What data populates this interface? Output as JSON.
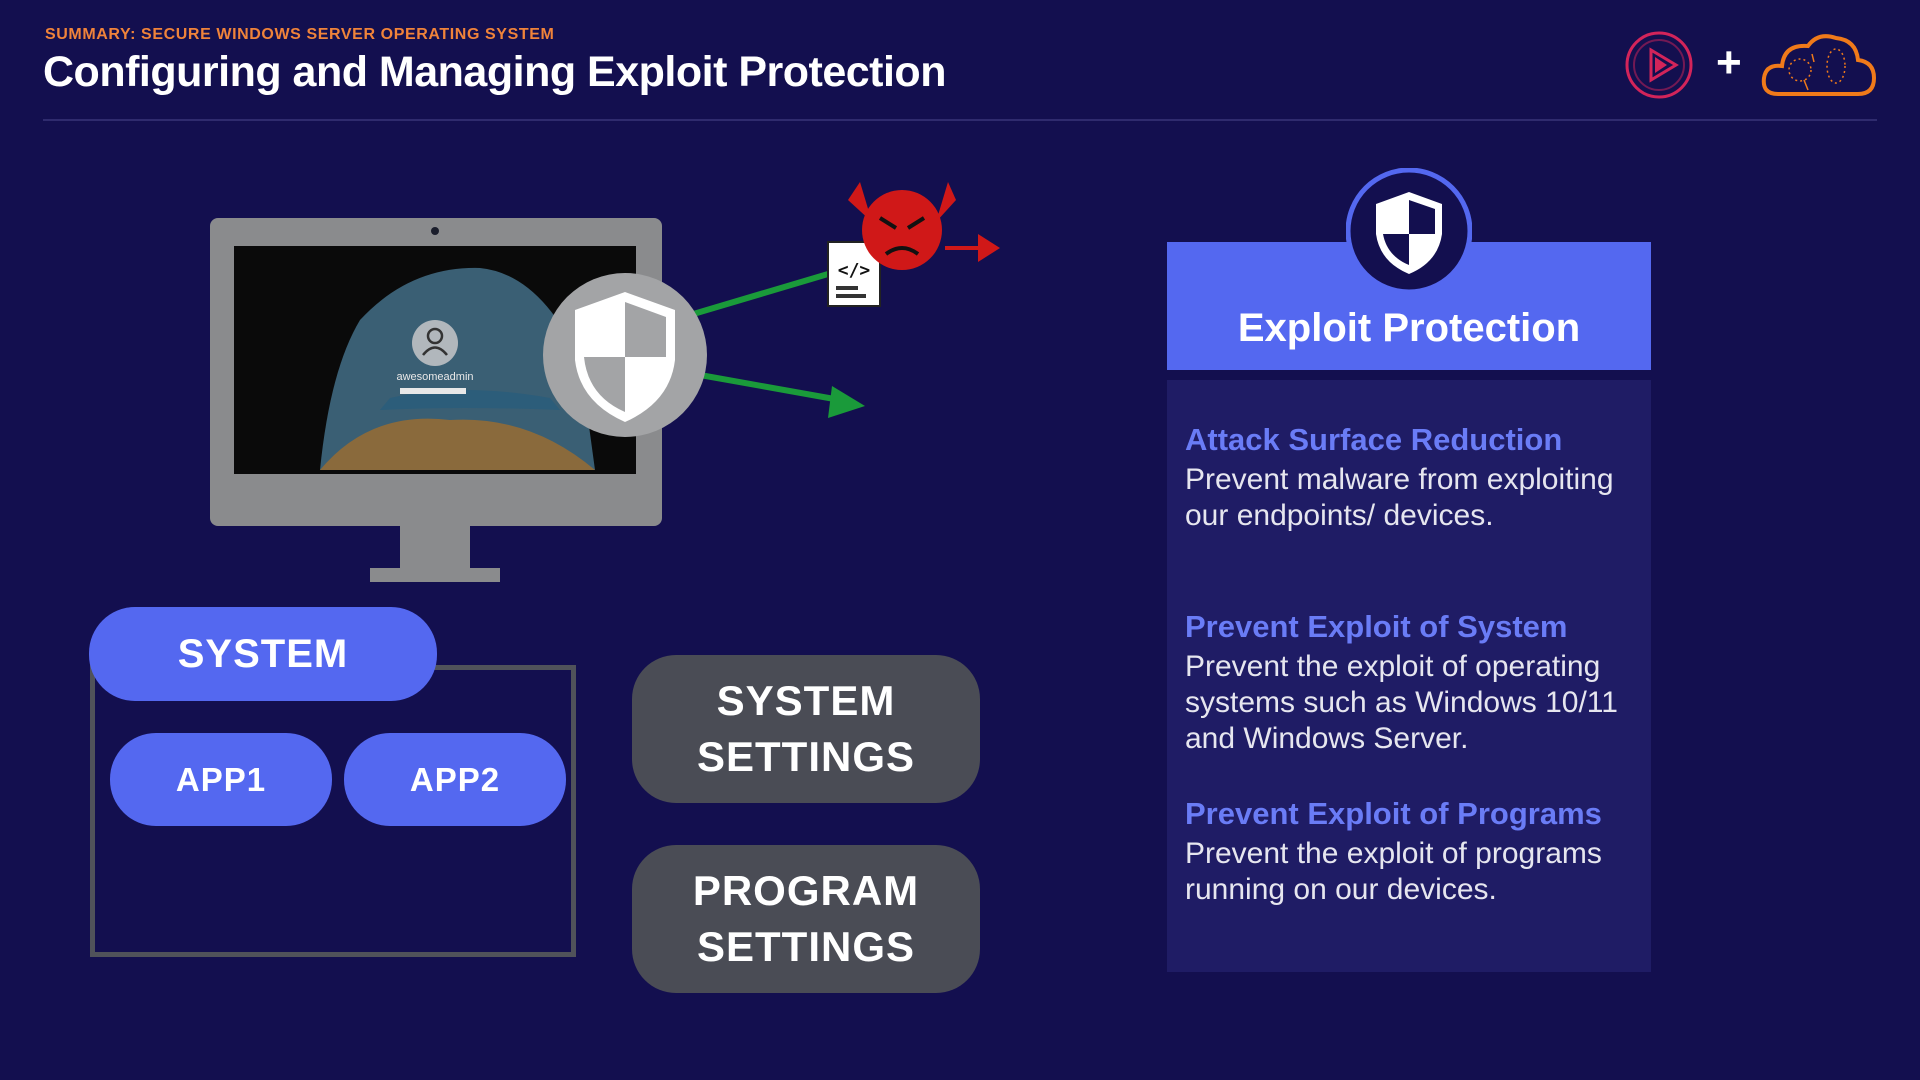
{
  "header": {
    "eyebrow": "SUMMARY: SECURE WINDOWS SERVER OPERATING SYSTEM",
    "title": "Configuring and Managing Exploit Protection",
    "plus": "+"
  },
  "brand": {
    "play_logo_icon": "pluralsight-play-logo-icon",
    "cloud_logo_icon": "cloud-logo-icon",
    "accent_pink": "#d3245a",
    "accent_orange": "#f07a1a"
  },
  "monitor": {
    "username": "awesomeadmin",
    "shield_icon": "shield-icon",
    "threat_icon": "devil-face-icon",
    "code_icon": "code-file-icon"
  },
  "diagram": {
    "system_label": "SYSTEM",
    "app1_label": "APP1",
    "app2_label": "APP2",
    "system_settings_line1": "SYSTEM",
    "system_settings_line2": "SETTINGS",
    "program_settings_line1": "PROGRAM",
    "program_settings_line2": "SETTINGS"
  },
  "panel": {
    "title": "Exploit Protection",
    "items": [
      {
        "heading": "Attack Surface Reduction",
        "text": "Prevent malware from exploiting our endpoints/ devices."
      },
      {
        "heading": "Prevent Exploit of System",
        "text": "Prevent the exploit of operating systems such as Windows 10/11 and Windows Server."
      },
      {
        "heading": "Prevent Exploit of Programs",
        "text": "Prevent the exploit of programs running on our devices."
      }
    ]
  },
  "colors": {
    "background": "#130f4f",
    "primary_blue": "#5468f0",
    "panel_body": "#1f1c65",
    "heading_blue": "#6a7cf6",
    "eyebrow_orange": "#f0833a",
    "pill_grey": "#4a4c55",
    "arrow_green": "#1a9a3a",
    "arrow_red": "#d01818"
  }
}
